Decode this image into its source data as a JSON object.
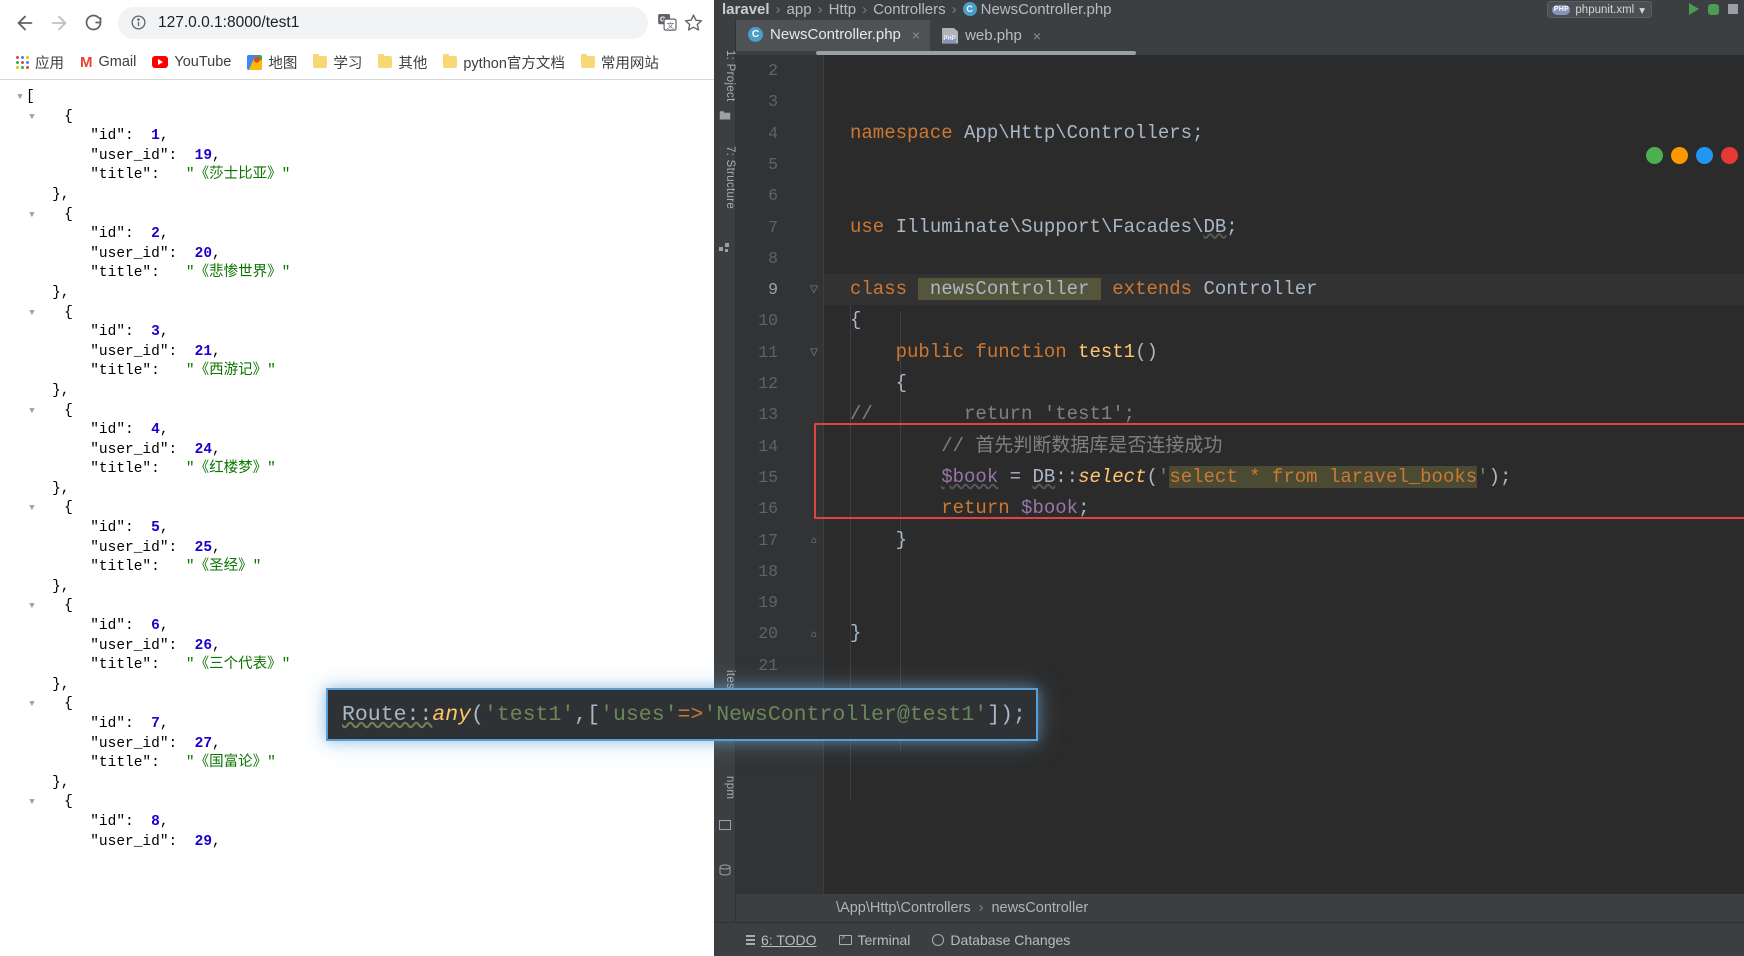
{
  "browser": {
    "nav": {
      "back_label": "Back",
      "forward_label": "Forward",
      "reload_label": "Reload"
    },
    "omnibox": {
      "url": "127.0.0.1:8000/test1",
      "info_icon": "info-circle-icon",
      "translate_icon": "translate-icon",
      "star_icon": "bookmark-star-icon"
    },
    "bookmarks": [
      {
        "label": "应用",
        "icon": "apps-grid-icon"
      },
      {
        "label": "Gmail",
        "icon": "gmail-icon"
      },
      {
        "label": "YouTube",
        "icon": "youtube-icon"
      },
      {
        "label": "地图",
        "icon": "google-maps-icon"
      },
      {
        "label": "学习",
        "icon": "folder-icon"
      },
      {
        "label": "其他",
        "icon": "folder-icon"
      },
      {
        "label": "python官方文档",
        "icon": "folder-icon"
      },
      {
        "label": "常用网站",
        "icon": "folder-icon"
      }
    ],
    "json_response": {
      "open_bracket": "[",
      "records": [
        {
          "id": 1,
          "user_id": 19,
          "title": "《莎士比亚》"
        },
        {
          "id": 2,
          "user_id": 20,
          "title": "《悲惨世界》"
        },
        {
          "id": 3,
          "user_id": 21,
          "title": "《西游记》"
        },
        {
          "id": 4,
          "user_id": 24,
          "title": "《红楼梦》"
        },
        {
          "id": 5,
          "user_id": 25,
          "title": "《圣经》"
        },
        {
          "id": 6,
          "user_id": 26,
          "title": "《三个代表》"
        },
        {
          "id": 7,
          "user_id": 27,
          "title": "《国富论》"
        },
        {
          "id": 8,
          "user_id": 29,
          "title": ""
        }
      ],
      "key_id": "\"id\"",
      "key_user_id": "\"user_id\"",
      "key_title": "\"title\"",
      "brace_open": "{",
      "brace_close": "},",
      "colon": ": ",
      "comma": ","
    }
  },
  "ide": {
    "breadcrumb": {
      "project": "laravel",
      "parts": [
        "app",
        "Http",
        "Controllers"
      ],
      "file": "NewsController.php",
      "class_icon": "php-class-icon"
    },
    "run_config": {
      "name": "phpunit.xml",
      "icon": "php-file-icon",
      "chevron": "▾"
    },
    "run_controls": [
      {
        "name": "run-button",
        "icon": "run-triangle-icon"
      },
      {
        "name": "debug-button",
        "icon": "debug-bug-icon"
      },
      {
        "name": "stop-button",
        "icon": "stop-square-icon"
      }
    ],
    "tabs": [
      {
        "label": "NewsController.php",
        "icon": "php-class-icon",
        "active": true,
        "close": "×"
      },
      {
        "label": "web.php",
        "icon": "php-file-icon",
        "active": false,
        "close": "×"
      }
    ],
    "tool_windows": [
      {
        "label": "1: Project",
        "name": "project-tool-window"
      },
      {
        "label": "7: Structure",
        "name": "structure-tool-window"
      },
      {
        "label": "npm",
        "name": "npm-tool-window"
      },
      {
        "label": "ites",
        "name": "favorites-tool-window"
      }
    ],
    "editor": {
      "line_numbers": [
        "2",
        "3",
        "4",
        "5",
        "6",
        "7",
        "8",
        "9",
        "10",
        "11",
        "12",
        "13",
        "14",
        "15",
        "16",
        "17",
        "18",
        "19",
        "20",
        "21"
      ],
      "current_line": "9",
      "lines": [
        {
          "n": "2",
          "text": ""
        },
        {
          "n": "3",
          "text": ""
        },
        {
          "n": "4",
          "text": "namespace App\\Http\\Controllers;"
        },
        {
          "n": "5",
          "text": ""
        },
        {
          "n": "6",
          "text": ""
        },
        {
          "n": "7",
          "text": "use Illuminate\\Support\\Facades\\DB;"
        },
        {
          "n": "8",
          "text": ""
        },
        {
          "n": "9",
          "text": "class newsController extends Controller"
        },
        {
          "n": "10",
          "text": "{"
        },
        {
          "n": "11",
          "text": "    public function test1()"
        },
        {
          "n": "12",
          "text": "    {"
        },
        {
          "n": "13",
          "text": "//        return 'test1';"
        },
        {
          "n": "14",
          "text": "        // 首先判断数据库是否连接成功"
        },
        {
          "n": "15",
          "text": "        $book = DB::select('select * from laravel_books');"
        },
        {
          "n": "16",
          "text": "        return $book;"
        },
        {
          "n": "17",
          "text": "    }"
        },
        {
          "n": "18",
          "text": ""
        },
        {
          "n": "19",
          "text": ""
        },
        {
          "n": "20",
          "text": "}"
        },
        {
          "n": "21",
          "text": ""
        }
      ],
      "highlighted_class": "newsController",
      "highlighted_sql": "select * from laravel_books",
      "comment_text": "首先判断数据库是否连接成功"
    },
    "bottom_breadcrumb": {
      "path": "\\App\\Http\\Controllers",
      "separator": "›",
      "symbol": "newsController"
    },
    "statusbar": [
      {
        "label": "6: TODO",
        "icon": "todo-list-icon",
        "underline_char": "6"
      },
      {
        "label": "Terminal",
        "icon": "terminal-icon"
      },
      {
        "label": "Database Changes",
        "icon": "database-icon"
      }
    ]
  },
  "route_popup": {
    "segments": [
      {
        "t": "Route::",
        "c": "r-route"
      },
      {
        "t": "any",
        "c": "r-any"
      },
      {
        "t": "(",
        "c": "r-punct"
      },
      {
        "t": "'test1'",
        "c": "r-str"
      },
      {
        "t": ",[",
        "c": "r-punct"
      },
      {
        "t": "'uses'",
        "c": "r-str"
      },
      {
        "t": "=>",
        "c": "r-arrow"
      },
      {
        "t": "'NewsController@test1'",
        "c": "r-str"
      },
      {
        "t": "]);",
        "c": "r-punct"
      }
    ],
    "full_text": "Route::any('test1',['uses'=>'NewsController@test1']);"
  },
  "colors": {
    "ide_chrome": "#3c3f41",
    "editor_bg": "#2b2b2b",
    "accent_blue": "#5a9ed6",
    "red_box": "#e04343",
    "json_number": "#1a01cc",
    "json_string": "#0b7500"
  }
}
